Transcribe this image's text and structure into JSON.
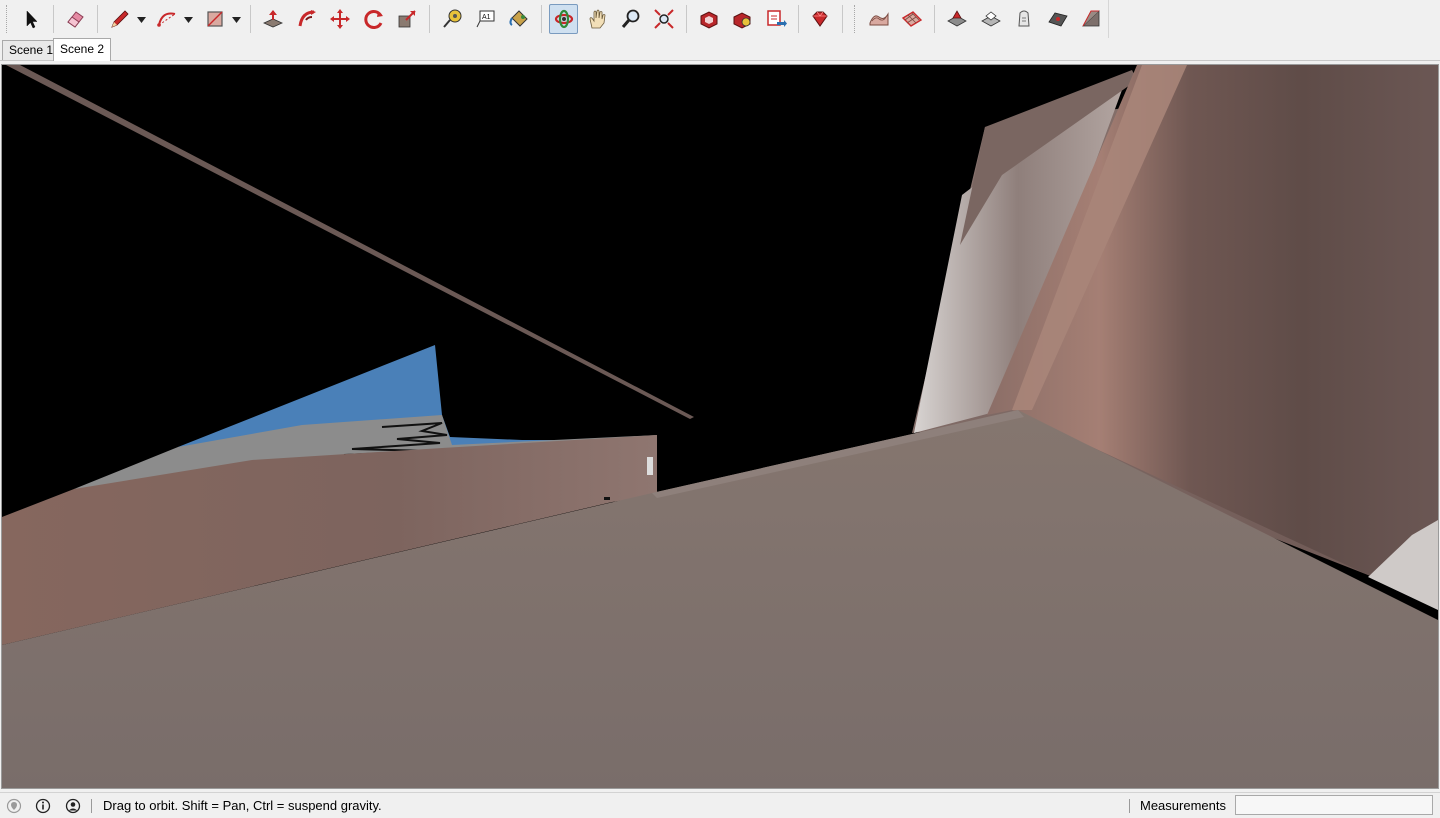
{
  "app": {
    "accent": "#7a9bbf",
    "toolbar_icons": [
      "select-icon",
      "eraser-icon",
      "pencil-line-icon",
      "arc-icon",
      "rectangle-icon",
      "push-pull-icon",
      "follow-me-icon",
      "move-icon",
      "rotate-icon",
      "scale-icon",
      "tape-measure-icon",
      "text-icon",
      "paint-bucket-icon",
      "orbit-icon",
      "pan-icon",
      "zoom-icon",
      "zoom-extents-icon",
      "warehouse-icon",
      "extension-warehouse-icon",
      "send-to-layout-icon",
      "ruby-console-icon",
      "sandbox-smoove-icon",
      "sandbox-from-scratch-icon",
      "sandbox-stamp-icon",
      "sandbox-drape-icon",
      "sandbox-add-detail-icon",
      "sandbox-flip-edge-icon",
      "sandbox-from-contours-icon"
    ],
    "active_tool": "orbit-icon"
  },
  "scenes": {
    "tabs": [
      {
        "label": "Scene 1",
        "selected": false
      },
      {
        "label": "Scene 2",
        "selected": true
      }
    ]
  },
  "statusbar": {
    "icons": [
      "geo-location-icon",
      "credits-icon",
      "account-icon"
    ],
    "message": "Drag to orbit. Shift = Pan, Ctrl = suspend gravity.",
    "measurements_label": "Measurements",
    "measurements_value": ""
  },
  "viewport": {
    "background": "#000000",
    "colors": {
      "floor": "#7d6f6b",
      "wall_left": "#7e6560",
      "sky_face": "#4a80b8",
      "grey_face": "#8c8c8c",
      "pillar_dark": "#6b5550",
      "pillar_light": "#a79a96"
    }
  }
}
